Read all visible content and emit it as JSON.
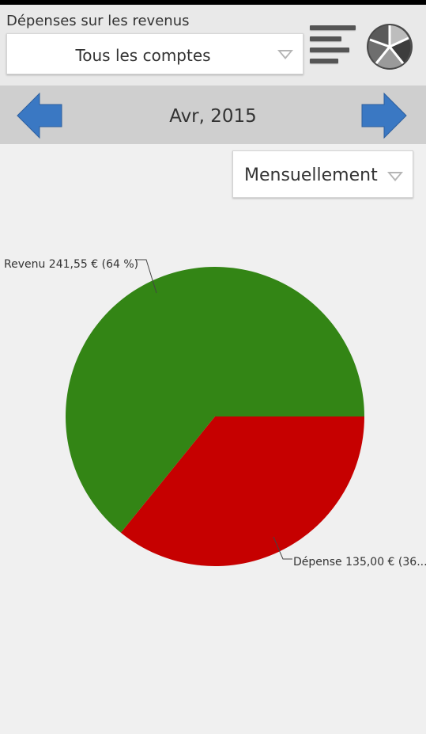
{
  "header": {
    "title": "Dépenses sur les revenus",
    "account_select": "Tous les comptes"
  },
  "nav": {
    "date": "Avr, 2015"
  },
  "period_select": "Mensuellement",
  "icons": {
    "prev": "arrow-left-icon",
    "next": "arrow-right-icon",
    "menu": "menu-icon",
    "chart_type": "pie-chart-icon"
  },
  "colors": {
    "revenu": "#338515",
    "depense": "#c60000",
    "arrow": "#3a78c3"
  },
  "chart_data": {
    "type": "pie",
    "slices": [
      {
        "label": "Revenu  241,55 € (64 %)",
        "value": 241.55,
        "color": "#338515"
      },
      {
        "label": "Dépense  135,00 € (36...",
        "value": 135.0,
        "color": "#c60000"
      }
    ]
  }
}
